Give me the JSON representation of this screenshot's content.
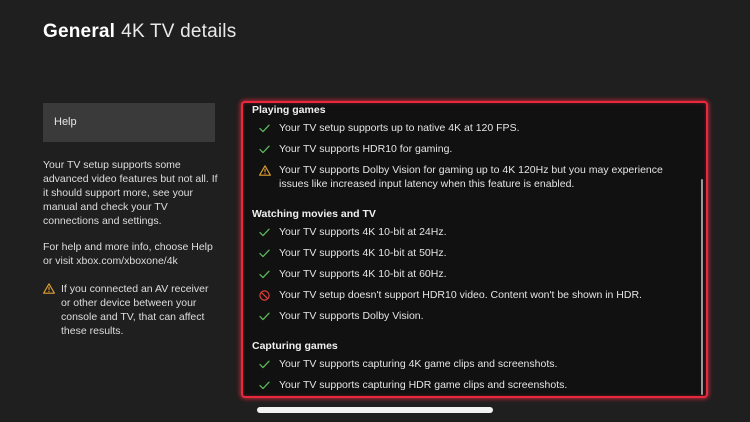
{
  "header": {
    "section": "General",
    "page": "4K TV details"
  },
  "sidebar": {
    "help_label": "Help",
    "paragraph1": "Your TV setup supports some advanced video features but not all. If it should support more, see your manual and check your TV connections and settings.",
    "paragraph2": "For help and more info, choose Help or visit xbox.com/xboxone/4k",
    "warning": "If you connected an AV receiver or other device between your console and TV, that can affect these results."
  },
  "groups": [
    {
      "title": "Playing games",
      "items": [
        {
          "status": "check-icon",
          "text": "Your TV setup supports up to native 4K at 120 FPS."
        },
        {
          "status": "check-icon",
          "text": "Your TV supports HDR10 for gaming."
        },
        {
          "status": "warning-icon",
          "text": "Your TV supports Dolby Vision for gaming up to 4K 120Hz but you may experience issues like increased input latency when this feature is enabled."
        }
      ]
    },
    {
      "title": "Watching movies and TV",
      "items": [
        {
          "status": "check-icon",
          "text": "Your TV supports 4K 10-bit at 24Hz."
        },
        {
          "status": "check-icon",
          "text": "Your TV supports 4K 10-bit at 50Hz."
        },
        {
          "status": "check-icon",
          "text": "Your TV supports 4K 10-bit at 60Hz."
        },
        {
          "status": "blocked-icon",
          "text": "Your TV setup doesn't support HDR10 video. Content won't be shown in HDR."
        },
        {
          "status": "check-icon",
          "text": "Your TV supports Dolby Vision."
        }
      ]
    },
    {
      "title": "Capturing games",
      "items": [
        {
          "status": "check-icon",
          "text": "Your TV supports capturing 4K game clips and screenshots."
        },
        {
          "status": "check-icon",
          "text": "Your TV supports capturing HDR game clips and screenshots."
        }
      ]
    }
  ],
  "colors": {
    "background": "#1f1f1f",
    "focus_border": "#e8283c",
    "check": "#5cb85c",
    "warning": "#e0a030",
    "blocked": "#e0403c"
  }
}
